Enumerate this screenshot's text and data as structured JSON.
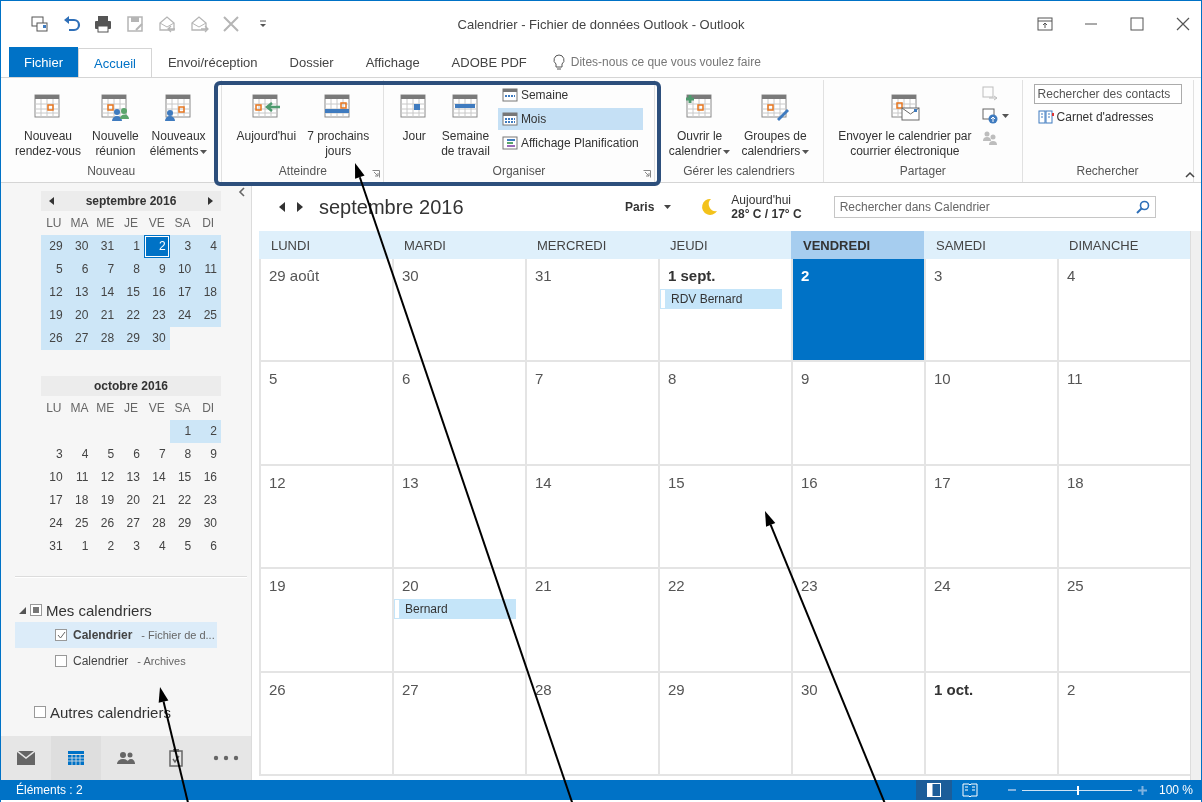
{
  "window": {
    "title": "Calendrier - Fichier de données Outlook - Outlook"
  },
  "quick_access": [
    {
      "kind": "send-receive",
      "disabled": false
    },
    {
      "kind": "undo",
      "disabled": false
    },
    {
      "kind": "print",
      "disabled": false
    },
    {
      "kind": "save",
      "disabled": true
    },
    {
      "kind": "reply",
      "disabled": true
    },
    {
      "kind": "forward",
      "disabled": true
    },
    {
      "kind": "delete",
      "disabled": true
    },
    {
      "kind": "customize",
      "disabled": false
    }
  ],
  "tabs": [
    {
      "label": "Fichier",
      "kind": "file",
      "selected": false
    },
    {
      "label": "Accueil",
      "kind": "tab",
      "selected": true
    },
    {
      "label": "Envoi/réception",
      "kind": "tab",
      "selected": false
    },
    {
      "label": "Dossier",
      "kind": "tab",
      "selected": false
    },
    {
      "label": "Affichage",
      "kind": "tab",
      "selected": false
    },
    {
      "label": "ADOBE PDF",
      "kind": "tab",
      "selected": false
    }
  ],
  "tell_me": {
    "placeholder": "Dites-nous ce que vous voulez faire"
  },
  "ribbon": {
    "groups": [
      {
        "label": "Nouveau",
        "launcher": false,
        "buttons": [
          {
            "kind": "large",
            "label": "Nouveau\nrendez-vous",
            "dropdown": false
          },
          {
            "kind": "large",
            "label": "Nouvelle\nréunion",
            "dropdown": false
          },
          {
            "kind": "large",
            "label": "Nouveaux\néléments",
            "dropdown": true
          }
        ]
      },
      {
        "label": "Atteindre",
        "launcher": true,
        "buttons": [
          {
            "kind": "large",
            "label": "Aujourd'hui",
            "dropdown": false
          },
          {
            "kind": "large",
            "label": "7 prochains\njours",
            "dropdown": false
          }
        ]
      },
      {
        "label": "Organiser",
        "launcher": true,
        "buttons": [
          {
            "kind": "large",
            "label": "Jour",
            "dropdown": false
          },
          {
            "kind": "large",
            "label": "Semaine\nde travail",
            "dropdown": false
          },
          {
            "kind": "small",
            "label": "Semaine",
            "selected": false
          },
          {
            "kind": "small",
            "label": "Mois",
            "selected": true
          },
          {
            "kind": "small",
            "label": "Affichage Planification",
            "selected": false
          }
        ]
      },
      {
        "label": "Gérer les calendriers",
        "launcher": false,
        "buttons": [
          {
            "kind": "large",
            "label": "Ouvrir le\ncalendrier",
            "dropdown": true
          },
          {
            "kind": "large",
            "label": "Groupes de\ncalendriers",
            "dropdown": true
          }
        ]
      },
      {
        "label": "Partager",
        "launcher": false,
        "buttons": [
          {
            "kind": "large",
            "label": "Envoyer le calendrier par\ncourrier électronique",
            "dropdown": false
          },
          {
            "kind": "icon",
            "disabled": true,
            "dropdown": false
          },
          {
            "kind": "icon",
            "disabled": false,
            "dropdown": true
          },
          {
            "kind": "icon",
            "disabled": true,
            "dropdown": false
          }
        ]
      },
      {
        "label": "Rechercher",
        "launcher": false,
        "buttons": [
          {
            "kind": "field",
            "placeholder": "Rechercher des contacts"
          },
          {
            "kind": "small",
            "label": "Carnet d'adresses",
            "selected": false
          }
        ]
      }
    ]
  },
  "mini_calendars": [
    {
      "title": "septembre 2016",
      "navigation": true,
      "weekdays": [
        "LU",
        "MA",
        "ME",
        "JE",
        "VE",
        "SA",
        "DI"
      ],
      "weeks": [
        [
          {
            "day": "29",
            "highlighted": true,
            "selected": false
          },
          {
            "day": "30",
            "highlighted": true,
            "selected": false
          },
          {
            "day": "31",
            "highlighted": true,
            "selected": false
          },
          {
            "day": "1",
            "highlighted": true,
            "selected": false
          },
          {
            "day": "2",
            "highlighted": true,
            "selected": true
          },
          {
            "day": "3",
            "highlighted": true,
            "selected": false
          },
          {
            "day": "4",
            "highlighted": true,
            "selected": false
          }
        ],
        [
          {
            "day": "5",
            "highlighted": true,
            "selected": false
          },
          {
            "day": "6",
            "highlighted": true,
            "selected": false
          },
          {
            "day": "7",
            "highlighted": true,
            "selected": false
          },
          {
            "day": "8",
            "highlighted": true,
            "selected": false
          },
          {
            "day": "9",
            "highlighted": true,
            "selected": false
          },
          {
            "day": "10",
            "highlighted": true,
            "selected": false
          },
          {
            "day": "11",
            "highlighted": true,
            "selected": false
          }
        ],
        [
          {
            "day": "12",
            "highlighted": true,
            "selected": false
          },
          {
            "day": "13",
            "highlighted": true,
            "selected": false
          },
          {
            "day": "14",
            "highlighted": true,
            "selected": false
          },
          {
            "day": "15",
            "highlighted": true,
            "selected": false
          },
          {
            "day": "16",
            "highlighted": true,
            "selected": false
          },
          {
            "day": "17",
            "highlighted": true,
            "selected": false
          },
          {
            "day": "18",
            "highlighted": true,
            "selected": false
          }
        ],
        [
          {
            "day": "19",
            "highlighted": true,
            "selected": false
          },
          {
            "day": "20",
            "highlighted": true,
            "selected": false
          },
          {
            "day": "21",
            "highlighted": true,
            "selected": false
          },
          {
            "day": "22",
            "highlighted": true,
            "selected": false
          },
          {
            "day": "23",
            "highlighted": true,
            "selected": false
          },
          {
            "day": "24",
            "highlighted": true,
            "selected": false
          },
          {
            "day": "25",
            "highlighted": true,
            "selected": false
          }
        ],
        [
          {
            "day": "26",
            "highlighted": true,
            "selected": false
          },
          {
            "day": "27",
            "highlighted": true,
            "selected": false
          },
          {
            "day": "28",
            "highlighted": true,
            "selected": false
          },
          {
            "day": "29",
            "highlighted": true,
            "selected": false
          },
          {
            "day": "30",
            "highlighted": true,
            "selected": false
          }
        ]
      ]
    },
    {
      "title": "octobre 2016",
      "navigation": false,
      "weekdays": [
        "LU",
        "MA",
        "ME",
        "JE",
        "VE",
        "SA",
        "DI"
      ],
      "weeks": [
        [
          {
            "day": "1",
            "highlighted": true,
            "selected": false
          },
          {
            "day": "2",
            "highlighted": true,
            "selected": false
          }
        ],
        [
          {
            "day": "3",
            "highlighted": false,
            "selected": false
          },
          {
            "day": "4",
            "highlighted": false,
            "selected": false
          },
          {
            "day": "5",
            "highlighted": false,
            "selected": false
          },
          {
            "day": "6",
            "highlighted": false,
            "selected": false
          },
          {
            "day": "7",
            "highlighted": false,
            "selected": false
          },
          {
            "day": "8",
            "highlighted": false,
            "selected": false
          },
          {
            "day": "9",
            "highlighted": false,
            "selected": false
          }
        ],
        [
          {
            "day": "10",
            "highlighted": false,
            "selected": false
          },
          {
            "day": "11",
            "highlighted": false,
            "selected": false
          },
          {
            "day": "12",
            "highlighted": false,
            "selected": false
          },
          {
            "day": "13",
            "highlighted": false,
            "selected": false
          },
          {
            "day": "14",
            "highlighted": false,
            "selected": false
          },
          {
            "day": "15",
            "highlighted": false,
            "selected": false
          },
          {
            "day": "16",
            "highlighted": false,
            "selected": false
          }
        ],
        [
          {
            "day": "17",
            "highlighted": false,
            "selected": false
          },
          {
            "day": "18",
            "highlighted": false,
            "selected": false
          },
          {
            "day": "19",
            "highlighted": false,
            "selected": false
          },
          {
            "day": "20",
            "highlighted": false,
            "selected": false
          },
          {
            "day": "21",
            "highlighted": false,
            "selected": false
          },
          {
            "day": "22",
            "highlighted": false,
            "selected": false
          },
          {
            "day": "23",
            "highlighted": false,
            "selected": false
          }
        ],
        [
          {
            "day": "24",
            "highlighted": false,
            "selected": false
          },
          {
            "day": "25",
            "highlighted": false,
            "selected": false
          },
          {
            "day": "26",
            "highlighted": false,
            "selected": false
          },
          {
            "day": "27",
            "highlighted": false,
            "selected": false
          },
          {
            "day": "28",
            "highlighted": false,
            "selected": false
          },
          {
            "day": "29",
            "highlighted": false,
            "selected": false
          },
          {
            "day": "30",
            "highlighted": false,
            "selected": false
          }
        ],
        [
          {
            "day": "31",
            "highlighted": false,
            "selected": false
          },
          {
            "day": "1",
            "highlighted": false,
            "selected": false
          },
          {
            "day": "2",
            "highlighted": false,
            "selected": false
          },
          {
            "day": "3",
            "highlighted": false,
            "selected": false
          },
          {
            "day": "4",
            "highlighted": false,
            "selected": false
          },
          {
            "day": "5",
            "highlighted": false,
            "selected": false
          },
          {
            "day": "6",
            "highlighted": false,
            "selected": false
          }
        ]
      ]
    }
  ],
  "folders": [
    {
      "label": "Mes calendriers",
      "expanded": true,
      "mixed": true,
      "checked": false,
      "children": [
        {
          "name": "Calendrier",
          "detail": "- Fichier de d...",
          "checked": true,
          "selected": true
        },
        {
          "name": "Calendrier",
          "detail": "- Archives",
          "checked": false,
          "selected": false
        }
      ]
    },
    {
      "label": "Autres calendriers",
      "mixed": false,
      "checked": false
    }
  ],
  "nav_bar": [
    {
      "kind": "mail",
      "selected": false
    },
    {
      "kind": "calendar",
      "selected": true
    },
    {
      "kind": "people",
      "selected": false
    },
    {
      "kind": "tasks",
      "selected": false
    },
    {
      "kind": "more",
      "selected": false
    }
  ],
  "calendar": {
    "title": "septembre 2016",
    "weather": {
      "city": "Paris",
      "label": "Aujourd'hui",
      "temperature": "28° C / 17° C"
    },
    "search": {
      "placeholder": "Rechercher dans Calendrier"
    },
    "columns": [
      {
        "label": "LUNDI",
        "today": false
      },
      {
        "label": "MARDI",
        "today": false
      },
      {
        "label": "MERCREDI",
        "today": false
      },
      {
        "label": "JEUDI",
        "today": false
      },
      {
        "label": "VENDREDI",
        "today": true
      },
      {
        "label": "SAMEDI",
        "today": false
      },
      {
        "label": "DIMANCHE",
        "today": false
      }
    ],
    "weeks": [
      [
        {
          "label": "29 août",
          "bold": false,
          "today": false
        },
        {
          "label": "30",
          "bold": false,
          "today": false
        },
        {
          "label": "31",
          "bold": false,
          "today": false
        },
        {
          "label": "1 sept.",
          "bold": true,
          "today": false,
          "events": [
            "RDV Bernard"
          ]
        },
        {
          "label": "2",
          "bold": false,
          "today": true
        },
        {
          "label": "3",
          "bold": false,
          "today": false
        },
        {
          "label": "4",
          "bold": false,
          "today": false
        }
      ],
      [
        {
          "label": "5",
          "bold": false,
          "today": false
        },
        {
          "label": "6",
          "bold": false,
          "today": false
        },
        {
          "label": "7",
          "bold": false,
          "today": false
        },
        {
          "label": "8",
          "bold": false,
          "today": false
        },
        {
          "label": "9",
          "bold": false,
          "today": false
        },
        {
          "label": "10",
          "bold": false,
          "today": false
        },
        {
          "label": "11",
          "bold": false,
          "today": false
        }
      ],
      [
        {
          "label": "12",
          "bold": false,
          "today": false
        },
        {
          "label": "13",
          "bold": false,
          "today": false
        },
        {
          "label": "14",
          "bold": false,
          "today": false
        },
        {
          "label": "15",
          "bold": false,
          "today": false
        },
        {
          "label": "16",
          "bold": false,
          "today": false
        },
        {
          "label": "17",
          "bold": false,
          "today": false
        },
        {
          "label": "18",
          "bold": false,
          "today": false
        }
      ],
      [
        {
          "label": "19",
          "bold": false,
          "today": false
        },
        {
          "label": "20",
          "bold": false,
          "today": false,
          "events": [
            "Bernard"
          ]
        },
        {
          "label": "21",
          "bold": false,
          "today": false
        },
        {
          "label": "22",
          "bold": false,
          "today": false
        },
        {
          "label": "23",
          "bold": false,
          "today": false
        },
        {
          "label": "24",
          "bold": false,
          "today": false
        },
        {
          "label": "25",
          "bold": false,
          "today": false
        }
      ],
      [
        {
          "label": "26",
          "bold": false,
          "today": false
        },
        {
          "label": "27",
          "bold": false,
          "today": false
        },
        {
          "label": "28",
          "bold": false,
          "today": false
        },
        {
          "label": "29",
          "bold": false,
          "today": false
        },
        {
          "label": "30",
          "bold": false,
          "today": false
        },
        {
          "label": "1 oct.",
          "bold": true,
          "today": false
        },
        {
          "label": "2",
          "bold": false,
          "today": false
        }
      ]
    ]
  },
  "status_bar": {
    "text": "Éléments : 2",
    "views": [
      {
        "kind": "normal",
        "selected": true
      },
      {
        "kind": "reading",
        "selected": false
      }
    ],
    "zoom": {
      "level": 0.5,
      "reading": "100 %"
    }
  }
}
